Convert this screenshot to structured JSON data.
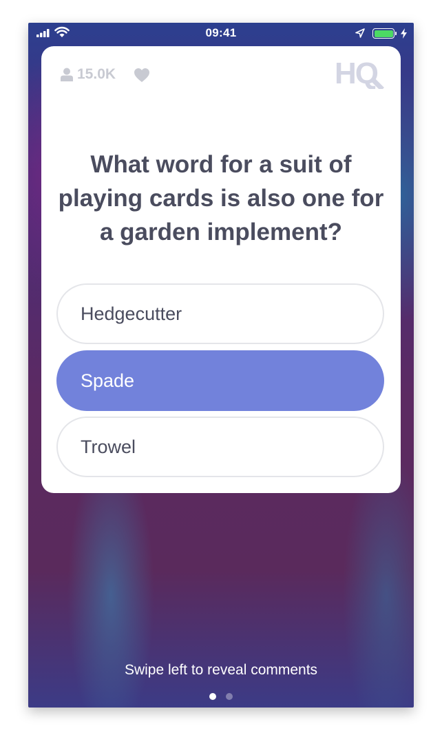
{
  "status_bar": {
    "time": "09:41",
    "icons": [
      "signal-icon",
      "wifi-icon",
      "location-arrow-icon",
      "battery-icon",
      "charging-bolt-icon"
    ],
    "battery_color": "#4cd964"
  },
  "header": {
    "viewers_icon": "person-icon",
    "viewer_count": "15.0K",
    "heart_icon": "heart-icon",
    "logo_text": "HQ"
  },
  "question": {
    "text": "What word for a suit of playing cards is also one for a garden implement?"
  },
  "answers": [
    {
      "label": "Hedgecutter",
      "selected": false
    },
    {
      "label": "Spade",
      "selected": true
    },
    {
      "label": "Trowel",
      "selected": false
    }
  ],
  "footer": {
    "hint": "Swipe left to reveal comments",
    "page_count": 2,
    "active_page": 1
  },
  "colors": {
    "selected_answer": "#7282db",
    "question_text": "#4a4c5e",
    "muted_header": "#c8cad2",
    "logo": "#d3d5e3"
  }
}
